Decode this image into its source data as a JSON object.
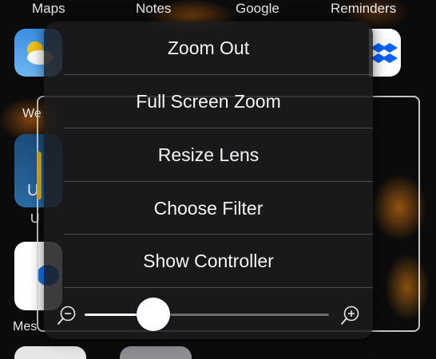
{
  "home_screen": {
    "app_labels": [
      "Maps",
      "Notes",
      "Google",
      "Reminders"
    ],
    "partial_labels": [
      "We",
      "U",
      "U",
      "Mes"
    ]
  },
  "zoom_menu": {
    "items": [
      {
        "label": "Zoom Out"
      },
      {
        "label": "Full Screen Zoom"
      },
      {
        "label": "Resize Lens"
      },
      {
        "label": "Choose Filter"
      },
      {
        "label": "Show Controller"
      }
    ],
    "zoom_level_fraction": 0.28,
    "icons": {
      "decrease": "zoom-out-magnifier-icon",
      "increase": "zoom-in-magnifier-icon"
    }
  },
  "colors": {
    "menu_background": "#1c1c1e",
    "text": "#f4f4f4",
    "track_filled": "#ffffff",
    "track_empty": "#6f6f6f",
    "lens_handle": "#d9b227"
  }
}
